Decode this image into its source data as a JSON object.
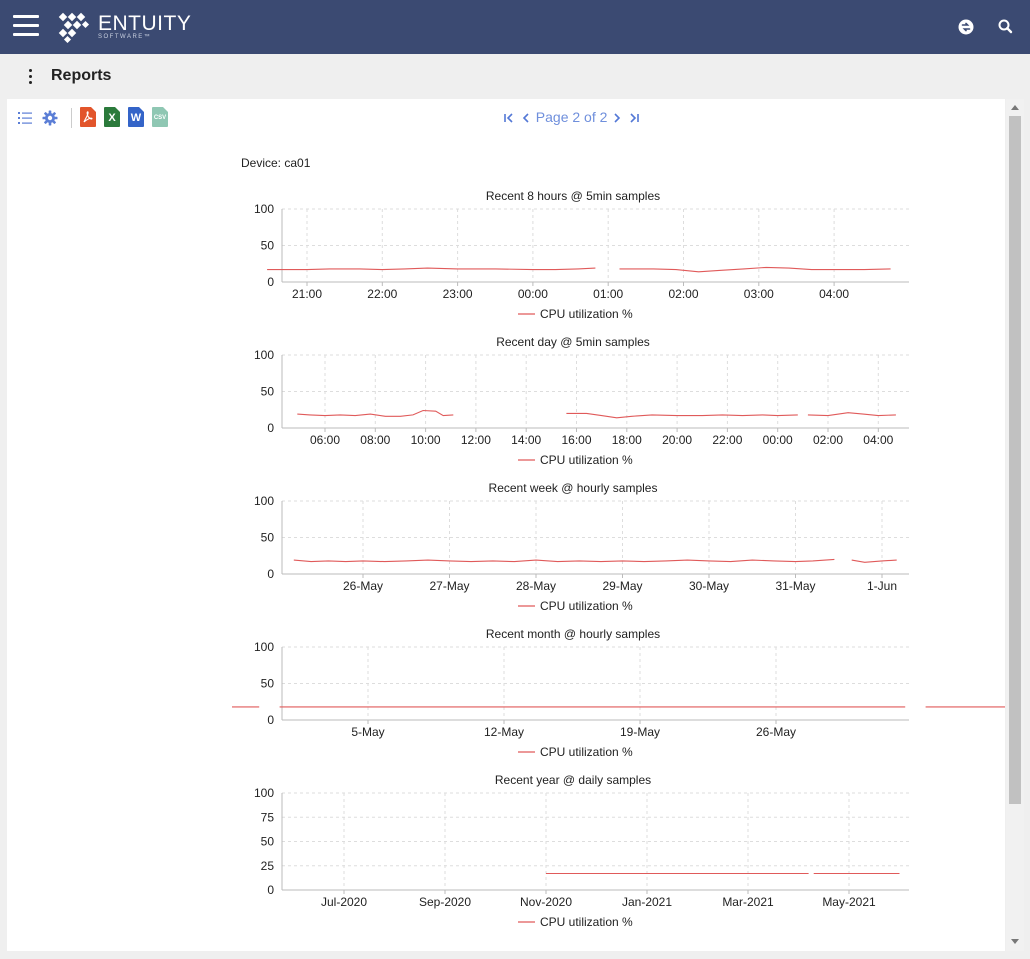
{
  "header": {
    "brand": "ENTUITY",
    "brand_sub": "SOFTWARE™",
    "bg_color": "#3b4a72",
    "icons": [
      "menu-icon",
      "user-switch-icon",
      "search-icon"
    ]
  },
  "subheader": {
    "title": "Reports"
  },
  "toolbar": {
    "icons": [
      "list-icon",
      "gear-icon",
      "pdf-icon",
      "excel-icon",
      "word-icon",
      "csv-icon"
    ],
    "excel_letter": "X",
    "word_letter": "W",
    "csv_letter": "CSV",
    "pager": {
      "text": "Page 2 of 2",
      "first": "|<",
      "prev": "<",
      "next": ">",
      "last": ">|"
    }
  },
  "report": {
    "device_label": "Device: ca01"
  },
  "colors": {
    "series": "#e05a5a",
    "grid": "#dddddd",
    "axis": "#bbbbbb"
  },
  "chart_data": [
    {
      "type": "line",
      "title": "Recent 8 hours @ 5min samples",
      "ylim": [
        0,
        100
      ],
      "yticks": [
        0,
        50,
        100
      ],
      "x_ticks": [
        "21:00",
        "22:00",
        "23:00",
        "00:00",
        "01:00",
        "02:00",
        "03:00",
        "04:00"
      ],
      "grid": true,
      "legend": "bottom",
      "series": [
        {
          "name": "CPU utilization %",
          "segments": [
            [
              [
                -0.53,
                17
              ],
              [
                -0.3,
                17
              ],
              [
                0,
                17
              ],
              [
                0.3,
                18
              ],
              [
                0.7,
                18
              ],
              [
                1,
                17
              ],
              [
                1.3,
                18
              ],
              [
                1.6,
                19
              ],
              [
                2,
                18
              ],
              [
                2.5,
                18
              ],
              [
                3,
                17
              ],
              [
                3.3,
                17
              ],
              [
                3.6,
                18
              ],
              [
                3.83,
                19
              ]
            ],
            [
              [
                4.15,
                18
              ],
              [
                4.6,
                18
              ],
              [
                4.9,
                17
              ],
              [
                5.2,
                14
              ],
              [
                5.5,
                16
              ],
              [
                5.8,
                18
              ],
              [
                6.1,
                20
              ],
              [
                6.4,
                19
              ],
              [
                6.7,
                17
              ],
              [
                7,
                17
              ],
              [
                7.4,
                17
              ],
              [
                7.75,
                18
              ]
            ]
          ]
        }
      ]
    },
    {
      "type": "line",
      "title": "Recent day @ 5min samples",
      "ylim": [
        0,
        100
      ],
      "yticks": [
        0,
        50,
        100
      ],
      "x_ticks": [
        "06:00",
        "08:00",
        "10:00",
        "12:00",
        "14:00",
        "16:00",
        "18:00",
        "20:00",
        "22:00",
        "00:00",
        "02:00",
        "04:00"
      ],
      "grid": true,
      "legend": "bottom",
      "series": [
        {
          "name": "CPU utilization %",
          "segments": [
            [
              [
                -0.55,
                19
              ],
              [
                -0.3,
                18
              ],
              [
                0,
                17
              ],
              [
                0.3,
                18
              ],
              [
                0.6,
                17
              ],
              [
                0.9,
                19
              ],
              [
                1.2,
                16
              ],
              [
                1.5,
                16
              ],
              [
                1.75,
                18
              ],
              [
                1.95,
                24
              ],
              [
                2.2,
                23
              ],
              [
                2.35,
                17
              ],
              [
                2.55,
                18
              ]
            ],
            [
              [
                4.8,
                20
              ],
              [
                5.2,
                20
              ],
              [
                5.5,
                17
              ],
              [
                5.8,
                14
              ],
              [
                6.1,
                16
              ],
              [
                6.5,
                18
              ],
              [
                7,
                17
              ],
              [
                7.5,
                17
              ],
              [
                7.9,
                18
              ],
              [
                8.3,
                17
              ],
              [
                8.7,
                18
              ],
              [
                9,
                17
              ],
              [
                9.4,
                18
              ]
            ],
            [
              [
                9.6,
                18
              ],
              [
                10,
                17
              ],
              [
                10.4,
                21
              ],
              [
                10.7,
                19
              ],
              [
                11,
                17
              ],
              [
                11.35,
                18
              ]
            ]
          ]
        }
      ]
    },
    {
      "type": "line",
      "title": "Recent week @ hourly samples",
      "ylim": [
        0,
        100
      ],
      "yticks": [
        0,
        50,
        100
      ],
      "x_ticks": [
        "26-May",
        "27-May",
        "28-May",
        "29-May",
        "30-May",
        "31-May",
        "1-Jun"
      ],
      "grid": true,
      "legend": "bottom",
      "series": [
        {
          "name": "CPU utilization %",
          "segments": [
            [
              [
                -0.8,
                19
              ],
              [
                -0.6,
                17
              ],
              [
                -0.4,
                18
              ],
              [
                -0.2,
                17
              ],
              [
                0,
                18
              ],
              [
                0.25,
                17
              ],
              [
                0.5,
                18
              ],
              [
                0.75,
                19
              ],
              [
                1,
                18
              ],
              [
                1.25,
                17
              ],
              [
                1.5,
                18
              ],
              [
                1.75,
                17
              ],
              [
                2,
                19
              ],
              [
                2.25,
                17
              ],
              [
                2.5,
                18
              ],
              [
                2.75,
                17
              ],
              [
                3,
                18
              ],
              [
                3.25,
                17
              ],
              [
                3.5,
                18
              ],
              [
                3.75,
                19
              ],
              [
                4,
                18
              ],
              [
                4.25,
                17
              ],
              [
                4.5,
                19
              ],
              [
                4.75,
                18
              ],
              [
                5,
                17
              ],
              [
                5.2,
                18
              ],
              [
                5.45,
                20
              ]
            ],
            [
              [
                5.65,
                19
              ],
              [
                5.8,
                16
              ],
              [
                6,
                18
              ],
              [
                6.17,
                19
              ]
            ]
          ]
        }
      ]
    },
    {
      "type": "line",
      "title": "Recent month @ hourly samples",
      "ylim": [
        0,
        100
      ],
      "yticks": [
        0,
        50,
        100
      ],
      "x_ticks": [
        "5-May",
        "12-May",
        "19-May",
        "26-May"
      ],
      "grid": true,
      "legend": "bottom",
      "series": [
        {
          "name": "CPU utilization %",
          "segments": [
            [
              [
                -1.0,
                18
              ],
              [
                -0.8,
                18
              ]
            ],
            [
              [
                -0.65,
                18
              ],
              [
                0,
                18
              ],
              [
                0.5,
                18
              ],
              [
                1,
                18
              ],
              [
                1.5,
                18
              ],
              [
                2,
                18
              ],
              [
                2.5,
                18
              ],
              [
                3,
                18
              ],
              [
                3.5,
                18
              ],
              [
                3.95,
                18
              ]
            ],
            [
              [
                4.1,
                18
              ],
              [
                4.5,
                18
              ],
              [
                5,
                18
              ],
              [
                5.5,
                18
              ],
              [
                5.95,
                18
              ]
            ]
          ]
        }
      ]
    },
    {
      "type": "line",
      "title": "Recent year @ daily samples",
      "ylim": [
        0,
        100
      ],
      "yticks": [
        0,
        25,
        50,
        75,
        100
      ],
      "x_ticks": [
        "Jul-2020",
        "Sep-2020",
        "Nov-2020",
        "Jan-2021",
        "Mar-2021",
        "May-2021"
      ],
      "grid": true,
      "legend": "bottom",
      "series": [
        {
          "name": "CPU utilization %",
          "segments": [
            [
              [
                2.0,
                17
              ],
              [
                2.5,
                17
              ],
              [
                3,
                17
              ],
              [
                3.5,
                17
              ],
              [
                4,
                17
              ],
              [
                4.6,
                17
              ]
            ],
            [
              [
                4.65,
                17
              ],
              [
                5,
                17
              ],
              [
                5.5,
                17
              ]
            ]
          ]
        }
      ]
    }
  ]
}
